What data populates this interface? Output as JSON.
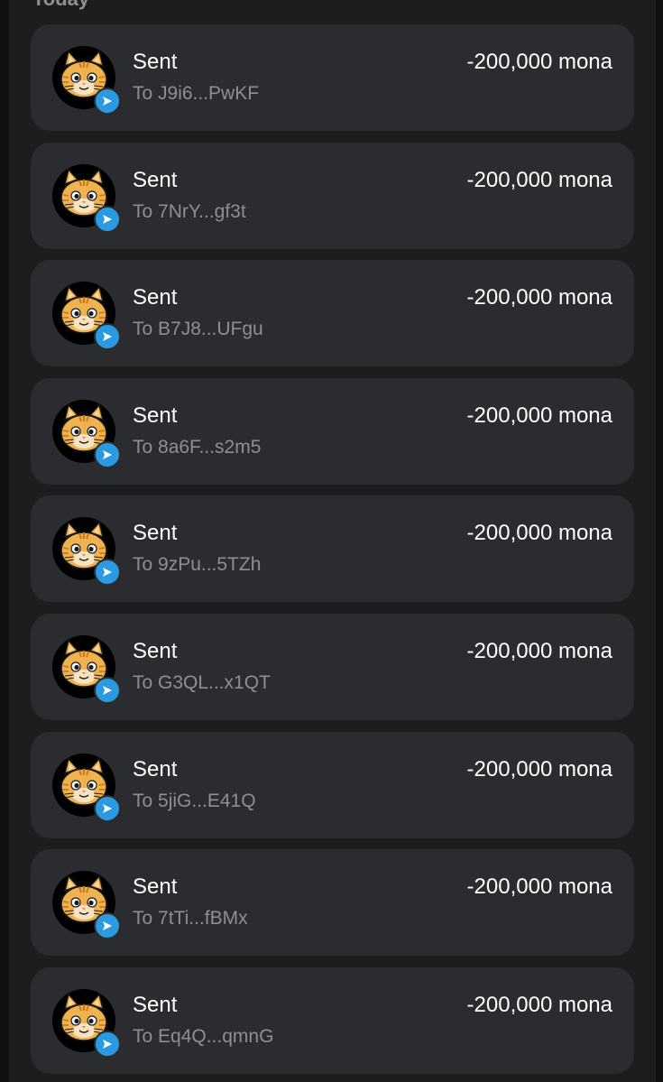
{
  "section": {
    "title": "Today"
  },
  "transactions": [
    {
      "title": "Sent",
      "recipient": "To J9i6...PwKF",
      "amount": "-200,000 mona",
      "avatar_icon": "cat-avatar-icon",
      "badge_icon": "send-arrow-icon"
    },
    {
      "title": "Sent",
      "recipient": "To 7NrY...gf3t",
      "amount": "-200,000 mona",
      "avatar_icon": "cat-avatar-icon",
      "badge_icon": "send-arrow-icon"
    },
    {
      "title": "Sent",
      "recipient": "To B7J8...UFgu",
      "amount": "-200,000 mona",
      "avatar_icon": "cat-avatar-icon",
      "badge_icon": "send-arrow-icon"
    },
    {
      "title": "Sent",
      "recipient": "To 8a6F...s2m5",
      "amount": "-200,000 mona",
      "avatar_icon": "cat-avatar-icon",
      "badge_icon": "send-arrow-icon"
    },
    {
      "title": "Sent",
      "recipient": "To 9zPu...5TZh",
      "amount": "-200,000 mona",
      "avatar_icon": "cat-avatar-icon",
      "badge_icon": "send-arrow-icon"
    },
    {
      "title": "Sent",
      "recipient": "To G3QL...x1QT",
      "amount": "-200,000 mona",
      "avatar_icon": "cat-avatar-icon",
      "badge_icon": "send-arrow-icon"
    },
    {
      "title": "Sent",
      "recipient": "To 5jiG...E41Q",
      "amount": "-200,000 mona",
      "avatar_icon": "cat-avatar-icon",
      "badge_icon": "send-arrow-icon"
    },
    {
      "title": "Sent",
      "recipient": "To 7tTi...fBMx",
      "amount": "-200,000 mona",
      "avatar_icon": "cat-avatar-icon",
      "badge_icon": "send-arrow-icon"
    },
    {
      "title": "Sent",
      "recipient": "To Eq4Q...qmnG",
      "amount": "-200,000 mona",
      "avatar_icon": "cat-avatar-icon",
      "badge_icon": "send-arrow-icon"
    }
  ],
  "colors": {
    "background": "#111112",
    "panel": "#1d1d1f",
    "card": "#2b2c30",
    "primary_text": "#ffffff",
    "secondary_text": "#8e8e93",
    "badge": "#2b9ae0",
    "avatar_fur": "#f0b24e"
  }
}
